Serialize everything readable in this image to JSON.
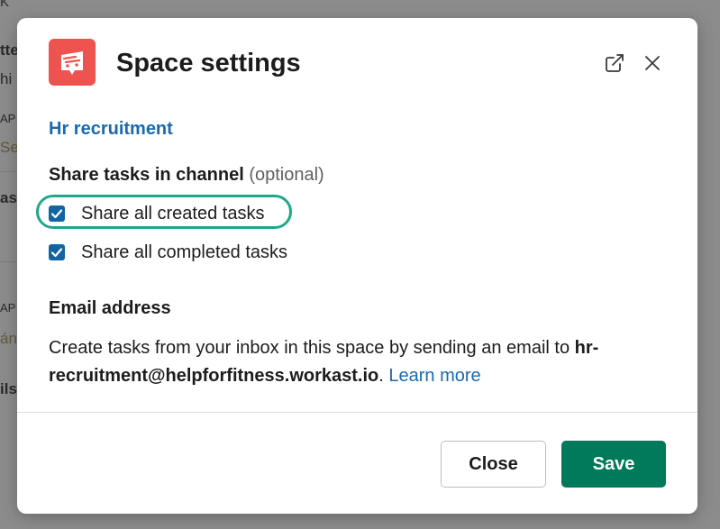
{
  "background": {
    "fragments": [
      "tte",
      "hi",
      "AP",
      "Set",
      "as",
      "AP",
      "án",
      "ils",
      "K"
    ]
  },
  "dialog": {
    "title": "Space settings",
    "logo_icon": "workast-logo-icon",
    "accent_color": "#ef5350"
  },
  "space": {
    "name": "Hr recruitment"
  },
  "share_section": {
    "label": "Share tasks in channel",
    "optional_note": "(optional)",
    "options": [
      {
        "label": "Share all created tasks",
        "checked": true,
        "highlighted": true
      },
      {
        "label": "Share all completed tasks",
        "checked": true,
        "highlighted": false
      }
    ]
  },
  "email_section": {
    "label": "Email address",
    "description_prefix": "Create tasks from your inbox in this space by sending an email to ",
    "email": "hr-recruitment@helpforfitness.workast.io",
    "description_suffix": ".",
    "learn_more": "Learn more"
  },
  "footer": {
    "close_label": "Close",
    "save_label": "Save",
    "save_color": "#007a5a"
  },
  "highlight_color": "#1ea88a",
  "link_color": "#1a6ab0"
}
